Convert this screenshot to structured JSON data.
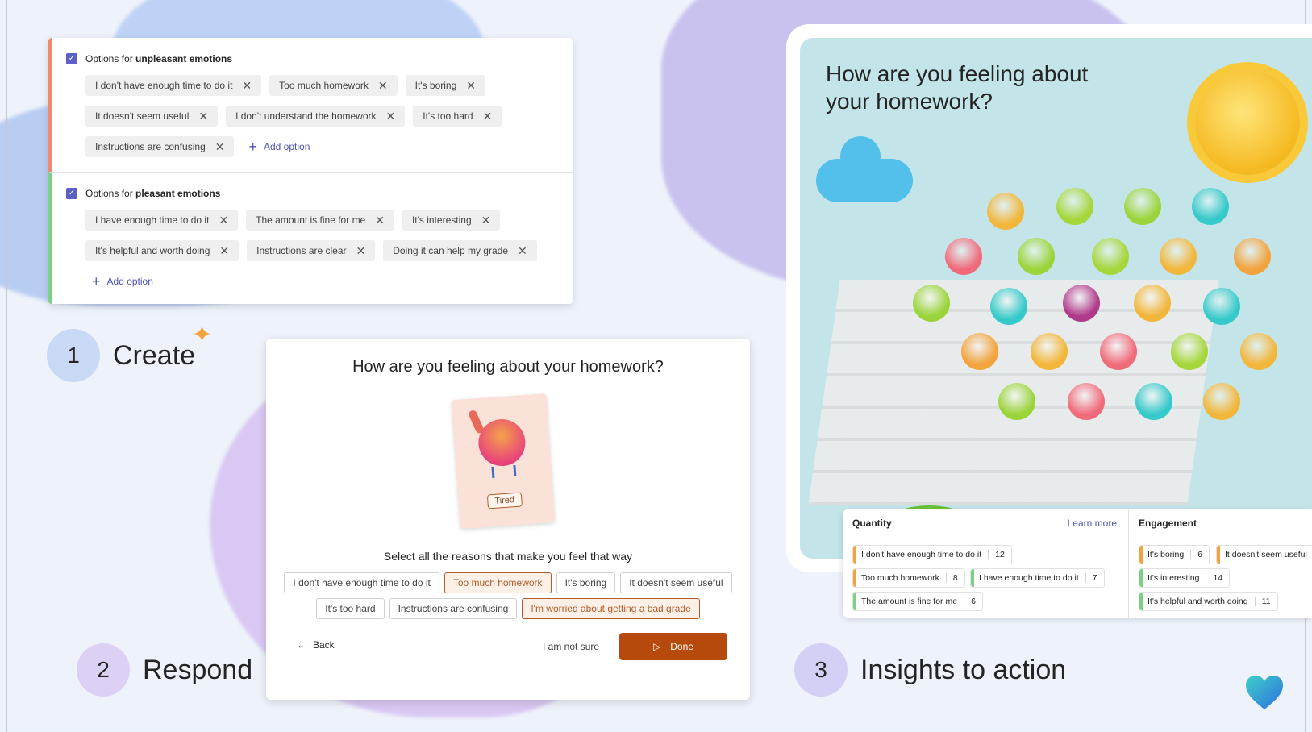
{
  "create_card": {
    "unpleasant": {
      "prefix": "Options for ",
      "bold": "unpleasant emotions",
      "options": [
        "I don't have enough time to do it",
        "Too much homework",
        "It's boring",
        "It doesn't seem useful",
        "I don't understand the homework",
        "It's too hard",
        "Instructions are confusing"
      ],
      "add_label": "Add option"
    },
    "pleasant": {
      "prefix": "Options for ",
      "bold": "pleasant emotions",
      "options": [
        "I have enough time to do it",
        "The amount is fine for me",
        "It's interesting",
        "It's helpful and worth doing",
        "Instructions are clear",
        "Doing it can help my grade"
      ],
      "add_label": "Add option"
    }
  },
  "steps": {
    "create": {
      "num": "1",
      "label": "Create"
    },
    "respond": {
      "num": "2",
      "label": "Respond"
    },
    "insights": {
      "num": "3",
      "label": "Insights to action"
    }
  },
  "respond_card": {
    "title": "How are you feeling about your homework?",
    "emotion_label": "Tired",
    "subtitle": "Select all the reasons that make you feel that way",
    "reasons": [
      {
        "label": "I don't have enough time to do it",
        "selected": false
      },
      {
        "label": "Too much homework",
        "selected": true
      },
      {
        "label": "It's boring",
        "selected": false
      },
      {
        "label": "It doesn't seem useful",
        "selected": false
      },
      {
        "label": "It's too hard",
        "selected": false
      },
      {
        "label": "Instructions are confusing",
        "selected": false
      },
      {
        "label": "I'm worried about getting a bad grade",
        "selected": true
      }
    ],
    "back_label": "Back",
    "not_sure_label": "I am not sure",
    "done_label": "Done",
    "accent": "#b54a0c"
  },
  "insights": {
    "scene_title": "How are you feeling about your homework?",
    "quantity": {
      "header": "Quantity",
      "learn_more": "Learn more",
      "items": [
        {
          "label": "I don't have enough time to do it",
          "count": "12",
          "color": "#f2a33c"
        },
        {
          "label": "Too much homework",
          "count": "8",
          "color": "#f2a33c"
        },
        {
          "label": "I have enough time to do it",
          "count": "7",
          "color": "#7ccf87"
        },
        {
          "label": "The amount is fine for me",
          "count": "6",
          "color": "#7ccf87"
        }
      ]
    },
    "engagement": {
      "header": "Engagement",
      "items": [
        {
          "label": "It's boring",
          "count": "6",
          "color": "#f2a33c"
        },
        {
          "label": "It doesn't seem useful",
          "count": "",
          "color": "#f2a33c"
        },
        {
          "label": "It's interesting",
          "count": "14",
          "color": "#7ccf87"
        },
        {
          "label": "It's helpful and worth doing",
          "count": "11",
          "color": "#7ccf87"
        }
      ]
    }
  }
}
